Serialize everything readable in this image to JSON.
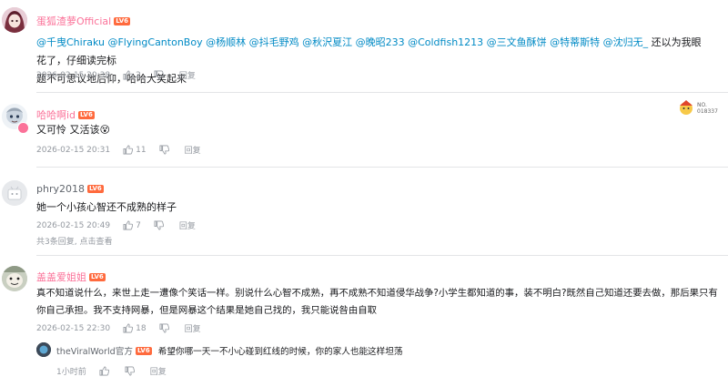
{
  "comments": [
    {
      "username": "蛋狐渣萝Official",
      "level": "LV6",
      "mentions": [
        "@千曳Chiraku",
        "@FlyingCantonBoy",
        "@杨顺林",
        "@抖毛野鸡",
        "@秋沢夏江",
        "@晚昭233",
        "@Coldfish1213",
        "@三文鱼酥饼",
        "@特蒂斯特",
        "@沈归无_"
      ],
      "text_line1_suffix": "还以为我眼花了，仔细读完标",
      "text_line2": "题不可思议地后仰，哈哈大笑起来",
      "time": "2026-02-15 20:38",
      "likes": "2",
      "reply_label": "回复"
    },
    {
      "username": "哈哈啊id",
      "level": "LV6",
      "text": "又可怜 又活该",
      "emoji": "😵",
      "time": "2026-02-15 20:31",
      "likes": "11",
      "reply_label": "回复",
      "badge_line1": "NO.",
      "badge_line2": "018337"
    },
    {
      "username": "phry2018",
      "level": "LV6",
      "text": "她一个小孩心智还不成熟的样子",
      "time": "2026-02-15 20:49",
      "likes": "7",
      "reply_label": "回复",
      "replies_count": "共3条回复,",
      "replies_link": "点击查看"
    },
    {
      "username": "盖盖爱姐姐",
      "level": "LV6",
      "text_line1": "真不知道说什么，来世上走一遭像个笑话一样。别说什么心智不成熟，再不成熟不知道侵华战争?小学生都知道的事，装不明白?既然自己知道还要去做，那后果只有",
      "text_line2": "你自己承担。我不支持网暴，但是网暴这个结果是她自己找的，我只能说咎由自取",
      "time": "2026-02-15 22:30",
      "likes": "18",
      "reply_label": "回复"
    }
  ],
  "nested_reply": {
    "username": "theViralWorld官方",
    "level": "LV6",
    "text": "希望你哪一天一不小心碰到红线的时候，你的家人也能这样坦荡",
    "time": "1小时前",
    "reply_label": "回复"
  }
}
